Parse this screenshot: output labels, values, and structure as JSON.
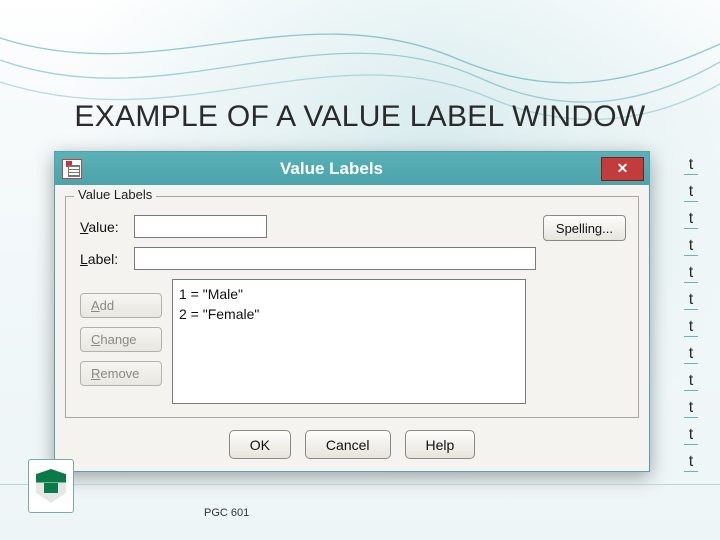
{
  "slide": {
    "title": "EXAMPLE OF A VALUE LABEL WINDOW",
    "footer_code": "PGC 601",
    "edge_char": "t"
  },
  "dialog": {
    "title": "Value Labels",
    "close_glyph": "✕",
    "fieldset_legend": "Value Labels",
    "value_label": "Value:",
    "label_label": "Label:",
    "value_input": "",
    "label_input": "",
    "spelling_btn": "Spelling...",
    "list_items": [
      "1 = \"Male\"",
      "2 = \"Female\""
    ],
    "side_buttons": {
      "add": "Add",
      "change": "Change",
      "remove": "Remove"
    },
    "bottom_buttons": {
      "ok": "OK",
      "cancel": "Cancel",
      "help": "Help"
    }
  }
}
